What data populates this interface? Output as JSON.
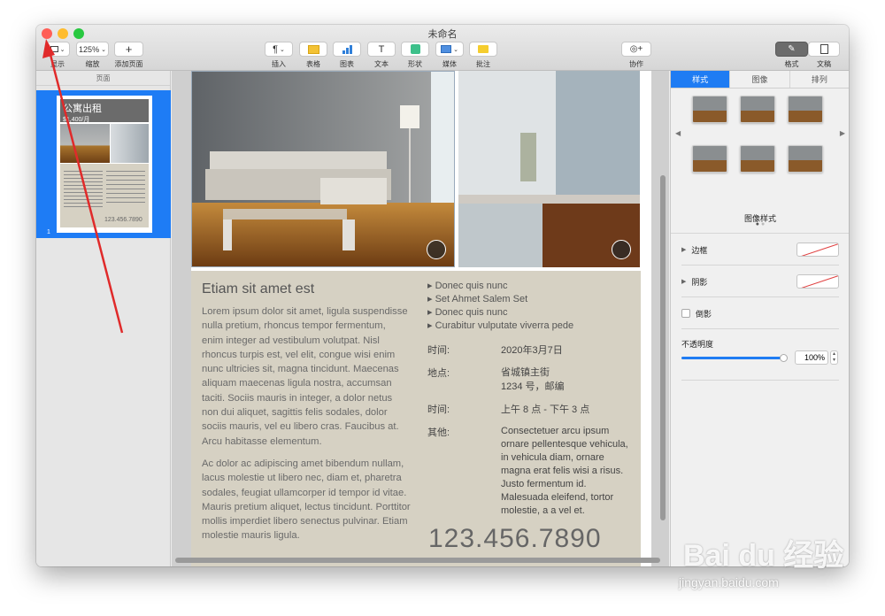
{
  "window": {
    "title": "未命名"
  },
  "toolbar": {
    "view_label": "显示",
    "zoom_value": "125%",
    "zoom_label": "缩放",
    "add_page_label": "添加页面",
    "insert_label": "插入",
    "table_label": "表格",
    "chart_label": "图表",
    "text_label": "文本",
    "shape_label": "形状",
    "media_label": "媒体",
    "comment_label": "批注",
    "collaborate_label": "协作",
    "format_label": "格式",
    "document_label": "文稿"
  },
  "sidebar": {
    "header": "页面",
    "page_number": "1",
    "thumb_title": "公寓出租",
    "thumb_price": "$1,400/月",
    "thumb_phone": "123.456.7890"
  },
  "document": {
    "heading": "Etiam sit amet est",
    "para1": "Lorem ipsum dolor sit amet, ligula suspendisse nulla pretium, rhoncus tempor fermentum, enim integer ad vestibulum volutpat. Nisl rhoncus turpis est, vel elit, congue wisi enim nunc ultricies sit, magna tincidunt. Maecenas aliquam maecenas ligula nostra, accumsan taciti. Sociis mauris in integer, a dolor netus non dui aliquet, sagittis felis sodales, dolor sociis mauris, vel eu libero cras. Faucibus at. Arcu habitasse elementum.",
    "para2": "Ac dolor ac adipiscing amet bibendum nullam, lacus molestie ut libero nec, diam et, pharetra sodales, feugiat ullamcorper id tempor id vitae. Mauris pretium aliquet, lectus tincidunt. Porttitor mollis imperdiet libero senectus pulvinar. Etiam molestie mauris ligula.",
    "bullets": [
      "Donec quis nunc",
      "Set Ahmet Salem Set",
      "Donec quis nunc",
      "Curabitur vulputate viverra pede"
    ],
    "details": [
      {
        "label": "时间:",
        "value": "2020年3月7日"
      },
      {
        "label": "地点:",
        "value": "省城镇主街\n1234 号，邮编"
      },
      {
        "label": "时间:",
        "value": "上午 8 点 - 下午 3 点"
      },
      {
        "label": "其他:",
        "value": "Consectetuer arcu ipsum ornare pellentesque vehicula, in vehicula diam, ornare magna erat felis wisi a risus. Justo fermentum id. Malesuada eleifend, tortor molestie, a a vel et."
      }
    ],
    "phone": "123.456.7890"
  },
  "panel": {
    "tabs": [
      "样式",
      "图像",
      "排列"
    ],
    "image_styles_label": "图像样式",
    "border_label": "边框",
    "shadow_label": "阴影",
    "reflection_label": "倒影",
    "opacity_label": "不透明度",
    "opacity_value": "100%",
    "opacity_level": 1.0
  },
  "watermark": {
    "brand": "Bai du 经验",
    "url": "jingyan.baidu.com"
  },
  "colors": {
    "accent": "#1f7cf3",
    "annotation_arrow": "#e02a2a",
    "info_box": "#d6d1c3"
  }
}
